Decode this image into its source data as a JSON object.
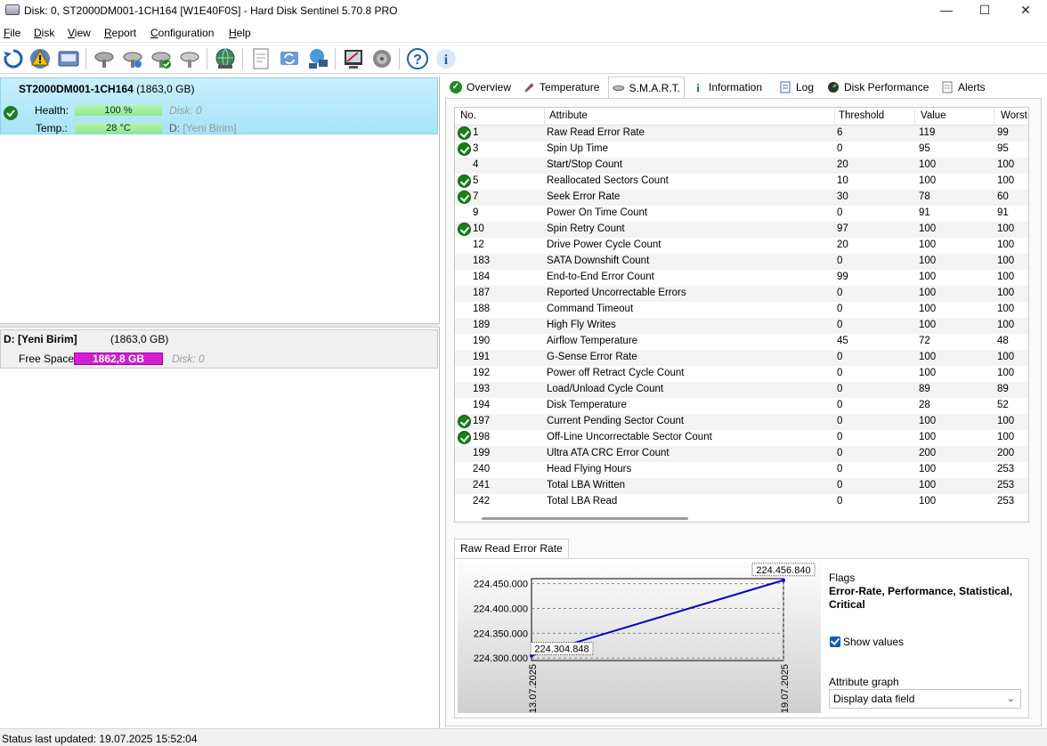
{
  "window": {
    "title": "Disk: 0, ST2000DM001-1CH164 [W1E40F0S]  -  Hard Disk Sentinel 5.70.8 PRO",
    "minimize": "—",
    "maximize": "☐",
    "close": "✕"
  },
  "menu": {
    "items": [
      {
        "label": "File",
        "u": "F",
        "rest": "ile"
      },
      {
        "label": "Disk",
        "u": "D",
        "rest": "isk"
      },
      {
        "label": "View",
        "u": "V",
        "rest": "iew"
      },
      {
        "label": "Report",
        "u": "R",
        "rest": "eport"
      },
      {
        "label": "Configuration",
        "u": "C",
        "rest": "onfiguration"
      },
      {
        "label": "Help",
        "u": "H",
        "rest": "elp"
      }
    ]
  },
  "toolbar": {
    "icons": [
      "refresh-icon",
      "alert-icon",
      "disk-info-icon",
      "test-disk-icon",
      "surface-test-icon",
      "disk-ok-icon",
      "disk-check-icon",
      "web-icon",
      "report-icon",
      "sync-icon",
      "network-icon",
      "settings-icon",
      "sound-icon",
      "help-icon",
      "about-icon"
    ]
  },
  "disk": {
    "name": "ST2000DM001-1CH164",
    "size": "(1863,0 GB)",
    "health_label": "Health:",
    "health_value": "100 %",
    "health_fraction": 1.0,
    "disk_ref": "Disk: 0",
    "temp_label": "Temp.:",
    "temp_value": "28 °C",
    "drive_letter": "D:",
    "drive_name": "[Yeni Birim]"
  },
  "volume": {
    "name": "D: [Yeni Birim]",
    "size": "(1863,0 GB)",
    "free_label": "Free Space",
    "free_value": "1862,8 GB",
    "disk_ref": "Disk: 0"
  },
  "tabs": [
    {
      "label": "Overview",
      "icon": "ok-icon"
    },
    {
      "label": "Temperature",
      "icon": "thermometer-icon"
    },
    {
      "label": "S.M.A.R.T.",
      "icon": "disk-icon",
      "active": true
    },
    {
      "label": "Information",
      "icon": "info-icon"
    },
    {
      "label": "Log",
      "icon": "log-icon"
    },
    {
      "label": "Disk Performance",
      "icon": "performance-icon"
    },
    {
      "label": "Alerts",
      "icon": "alerts-icon"
    }
  ],
  "smart": {
    "headers": [
      "No.",
      "Attribute",
      "Threshold",
      "Value",
      "Worst"
    ],
    "rows": [
      {
        "no": "1",
        "attr": "Raw Read Error Rate",
        "thr": "6",
        "val": "119",
        "worst": "99",
        "ok": true
      },
      {
        "no": "3",
        "attr": "Spin Up Time",
        "thr": "0",
        "val": "95",
        "worst": "95",
        "ok": true
      },
      {
        "no": "4",
        "attr": "Start/Stop Count",
        "thr": "20",
        "val": "100",
        "worst": "100",
        "ok": false
      },
      {
        "no": "5",
        "attr": "Reallocated Sectors Count",
        "thr": "10",
        "val": "100",
        "worst": "100",
        "ok": true
      },
      {
        "no": "7",
        "attr": "Seek Error Rate",
        "thr": "30",
        "val": "78",
        "worst": "60",
        "ok": true
      },
      {
        "no": "9",
        "attr": "Power On Time Count",
        "thr": "0",
        "val": "91",
        "worst": "91",
        "ok": false
      },
      {
        "no": "10",
        "attr": "Spin Retry Count",
        "thr": "97",
        "val": "100",
        "worst": "100",
        "ok": true
      },
      {
        "no": "12",
        "attr": "Drive Power Cycle Count",
        "thr": "20",
        "val": "100",
        "worst": "100",
        "ok": false
      },
      {
        "no": "183",
        "attr": "SATA Downshift Count",
        "thr": "0",
        "val": "100",
        "worst": "100",
        "ok": false
      },
      {
        "no": "184",
        "attr": "End-to-End Error Count",
        "thr": "99",
        "val": "100",
        "worst": "100",
        "ok": false
      },
      {
        "no": "187",
        "attr": "Reported Uncorrectable Errors",
        "thr": "0",
        "val": "100",
        "worst": "100",
        "ok": false
      },
      {
        "no": "188",
        "attr": "Command Timeout",
        "thr": "0",
        "val": "100",
        "worst": "100",
        "ok": false
      },
      {
        "no": "189",
        "attr": "High Fly Writes",
        "thr": "0",
        "val": "100",
        "worst": "100",
        "ok": false
      },
      {
        "no": "190",
        "attr": "Airflow Temperature",
        "thr": "45",
        "val": "72",
        "worst": "48",
        "ok": false
      },
      {
        "no": "191",
        "attr": "G-Sense Error Rate",
        "thr": "0",
        "val": "100",
        "worst": "100",
        "ok": false
      },
      {
        "no": "192",
        "attr": "Power off Retract Cycle Count",
        "thr": "0",
        "val": "100",
        "worst": "100",
        "ok": false
      },
      {
        "no": "193",
        "attr": "Load/Unload Cycle Count",
        "thr": "0",
        "val": "89",
        "worst": "89",
        "ok": false
      },
      {
        "no": "194",
        "attr": "Disk Temperature",
        "thr": "0",
        "val": "28",
        "worst": "52",
        "ok": false
      },
      {
        "no": "197",
        "attr": "Current Pending Sector Count",
        "thr": "0",
        "val": "100",
        "worst": "100",
        "ok": true
      },
      {
        "no": "198",
        "attr": "Off-Line Uncorrectable Sector Count",
        "thr": "0",
        "val": "100",
        "worst": "100",
        "ok": true
      },
      {
        "no": "199",
        "attr": "Ultra ATA CRC Error Count",
        "thr": "0",
        "val": "200",
        "worst": "200",
        "ok": false
      },
      {
        "no": "240",
        "attr": "Head Flying Hours",
        "thr": "0",
        "val": "100",
        "worst": "253",
        "ok": false
      },
      {
        "no": "241",
        "attr": "Total LBA Written",
        "thr": "0",
        "val": "100",
        "worst": "253",
        "ok": false
      },
      {
        "no": "242",
        "attr": "Total LBA Read",
        "thr": "0",
        "val": "100",
        "worst": "253",
        "ok": false
      }
    ]
  },
  "graph": {
    "tab_label": "Raw Read Error Rate",
    "flags_label": "Flags",
    "flags_value": "Error-Rate, Performance, Statistical, Critical",
    "show_values_label": "Show values",
    "show_values_checked": true,
    "attribute_graph_label": "Attribute graph",
    "attribute_graph_value": "Display data field"
  },
  "chart_data": {
    "type": "line",
    "x": [
      "13.07.2025",
      "19.07.2025"
    ],
    "series": [
      {
        "values": [
          224304848,
          224456840
        ]
      }
    ],
    "value_labels": [
      "224.304.848",
      "224.456.840"
    ],
    "y_ticks": [
      "224.300.000",
      "224.350.000",
      "224.400.000",
      "224.450.000"
    ],
    "ylim": [
      224295000,
      224460000
    ],
    "grid": true,
    "color": "#0000c8"
  },
  "status": {
    "text": "Status last updated: 19.07.2025 15:52:04"
  }
}
